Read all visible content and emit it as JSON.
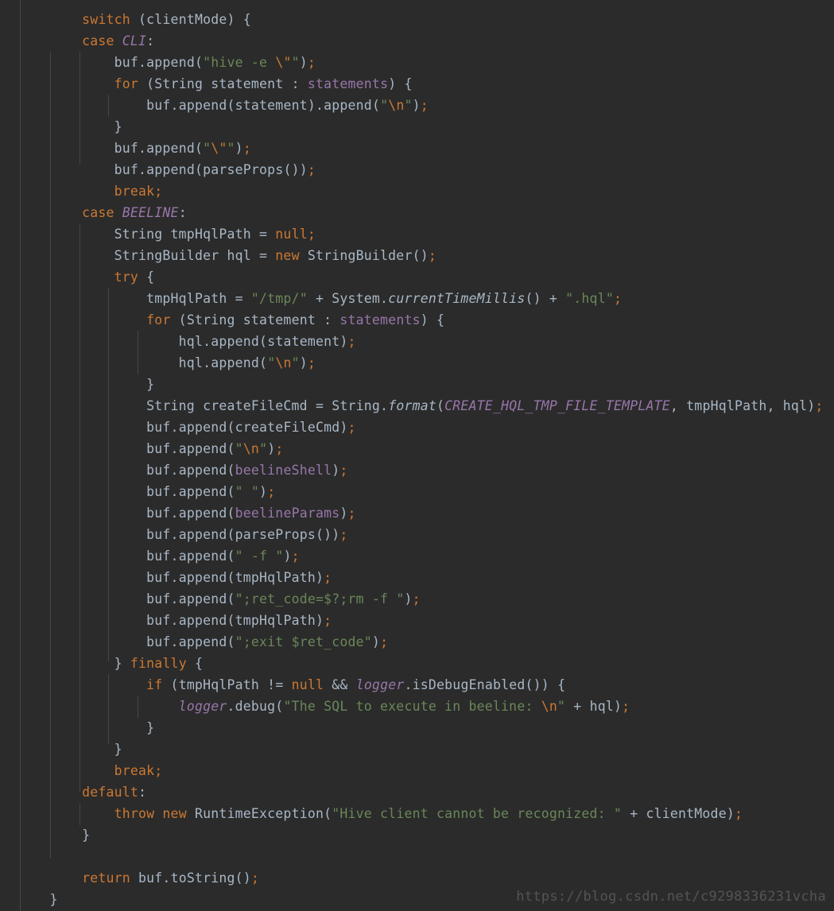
{
  "editor": {
    "background_color": "#2b2b2b",
    "default_text_color": "#a9b7c6",
    "theme_colors": {
      "keyword": "#cc7832",
      "string": "#6a8759",
      "field": "#9876aa",
      "static_constant": "#9876aa",
      "identifier": "#a9b7c6",
      "indent_guide": "#4b4b4b",
      "watermark": "#545454"
    },
    "language": "Java"
  },
  "watermark": {
    "text": "https://blog.csdn.net/c9298336231vcha"
  },
  "code": {
    "lines": [
      "        switch (clientMode) {",
      "        case CLI:",
      "            buf.append(\"hive -e \\\"\");",
      "            for (String statement : statements) {",
      "                buf.append(statement).append(\"\\n\");",
      "            }",
      "            buf.append(\"\\\"\");",
      "            buf.append(parseProps());",
      "            break;",
      "        case BEELINE:",
      "            String tmpHqlPath = null;",
      "            StringBuilder hql = new StringBuilder();",
      "            try {",
      "                tmpHqlPath = \"/tmp/\" + System.currentTimeMillis() + \".hql\";",
      "                for (String statement : statements) {",
      "                    hql.append(statement);",
      "                    hql.append(\"\\n\");",
      "                }",
      "                String createFileCmd = String.format(CREATE_HQL_TMP_FILE_TEMPLATE, tmpHqlPath, hql);",
      "                buf.append(createFileCmd);",
      "                buf.append(\"\\n\");",
      "                buf.append(beelineShell);",
      "                buf.append(\" \");",
      "                buf.append(beelineParams);",
      "                buf.append(parseProps());",
      "                buf.append(\" -f \");",
      "                buf.append(tmpHqlPath);",
      "                buf.append(\";ret_code=$?;rm -f \");",
      "                buf.append(tmpHqlPath);",
      "                buf.append(\";exit $ret_code\");",
      "            } finally {",
      "                if (tmpHqlPath != null && logger.isDebugEnabled()) {",
      "                    logger.debug(\"The SQL to execute in beeline: \\n\" + hql);",
      "                }",
      "            }",
      "            break;",
      "        default:",
      "            throw new RuntimeException(\"Hive client cannot be recognized: \" + clientMode);",
      "        }",
      "",
      "        return buf.toString();",
      "    }"
    ]
  }
}
